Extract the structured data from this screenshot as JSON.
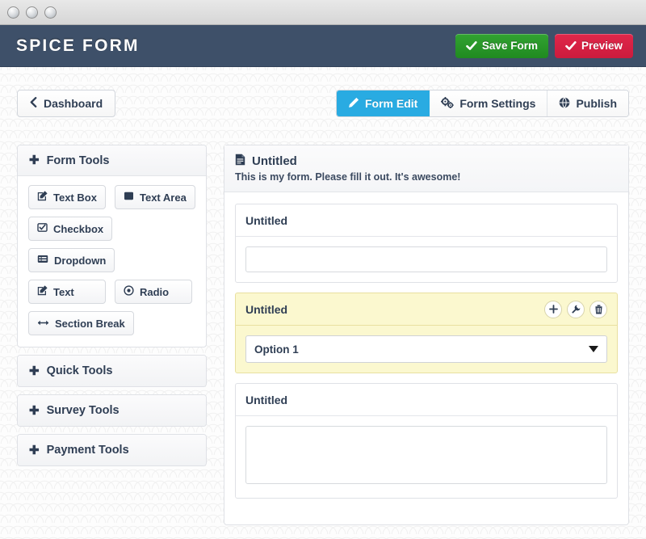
{
  "window": {
    "buttons": [
      "window-close",
      "window-minimize",
      "window-zoom"
    ]
  },
  "header": {
    "brand": "SPICE FORM",
    "save_label": "Save Form",
    "preview_label": "Preview",
    "save_color": "#2b9a2b",
    "preview_color": "#d81f42",
    "bar_color": "#3e5069"
  },
  "nav": {
    "back_label": "Dashboard",
    "tabs": [
      {
        "label": "Form Edit",
        "icon": "pencil-icon",
        "active": true
      },
      {
        "label": "Form Settings",
        "icon": "cogs-icon",
        "active": false
      },
      {
        "label": "Publish",
        "icon": "globe-icon",
        "active": false
      }
    ],
    "active_tab_color": "#29abe2"
  },
  "sidebar": {
    "panels": [
      {
        "title": "Form Tools",
        "expanded": true,
        "tools": [
          {
            "label": "Text Box",
            "icon": "pencil-square-icon"
          },
          {
            "label": "Text Area",
            "icon": "filled-square-icon"
          },
          {
            "label": "Checkbox",
            "icon": "check-square-icon"
          },
          {
            "label": "Dropdown",
            "icon": "list-alt-icon"
          },
          {
            "label": "Text",
            "icon": "pencil-square-icon"
          },
          {
            "label": "Radio",
            "icon": "dot-circle-icon"
          },
          {
            "label": "Section Break",
            "icon": "arrows-horizontal-icon"
          }
        ]
      },
      {
        "title": "Quick Tools",
        "expanded": false,
        "tools": []
      },
      {
        "title": "Survey Tools",
        "expanded": false,
        "tools": []
      },
      {
        "title": "Payment Tools",
        "expanded": false,
        "tools": []
      }
    ]
  },
  "builder": {
    "form_title": "Untitled",
    "form_title_icon": "file-text-icon",
    "form_description": "This is my form. Please fill it out. It's awesome!",
    "selected_highlight_color": "#fbf8cf",
    "fields": [
      {
        "label": "Untitled",
        "type": "textbox",
        "value": "",
        "placeholder": "",
        "selected": false
      },
      {
        "label": "Untitled",
        "type": "dropdown",
        "value": "Option 1",
        "options": [
          "Option 1"
        ],
        "selected": true,
        "tools": [
          {
            "name": "add-field-button",
            "icon": "plus-icon"
          },
          {
            "name": "field-settings-button",
            "icon": "wrench-icon"
          },
          {
            "name": "delete-field-button",
            "icon": "trash-icon"
          }
        ]
      },
      {
        "label": "Untitled",
        "type": "textarea",
        "value": "",
        "placeholder": "",
        "selected": false
      }
    ]
  }
}
